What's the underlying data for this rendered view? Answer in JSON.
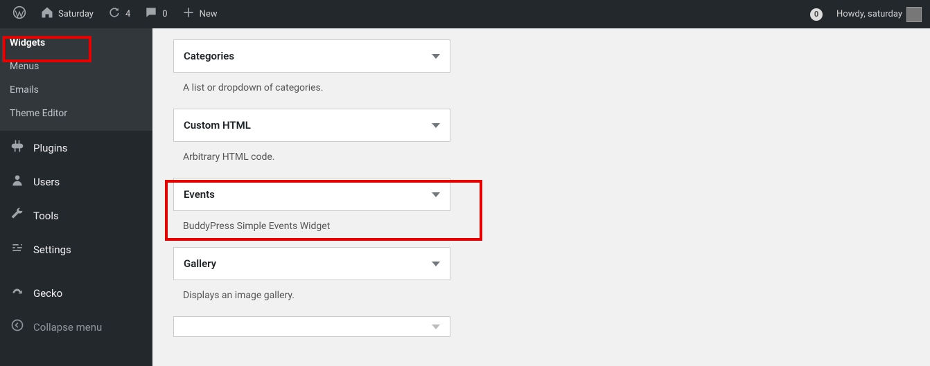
{
  "adminbar": {
    "site_name": "Saturday",
    "updates_count": "4",
    "comments_count": "0",
    "new_label": "New",
    "notif_count": "0",
    "greeting": "Howdy, saturday"
  },
  "sidebar": {
    "submenu": [
      {
        "label": "Widgets",
        "current": true
      },
      {
        "label": "Menus",
        "current": false
      },
      {
        "label": "Emails",
        "current": false
      },
      {
        "label": "Theme Editor",
        "current": false
      }
    ],
    "main": [
      {
        "icon": "plugin-icon",
        "label": "Plugins"
      },
      {
        "icon": "user-icon",
        "label": "Users"
      },
      {
        "icon": "wrench-icon",
        "label": "Tools"
      },
      {
        "icon": "sliders-icon",
        "label": "Settings"
      },
      {
        "icon": "lizard-icon",
        "label": "Gecko"
      }
    ],
    "collapse_label": "Collapse menu"
  },
  "widgets": [
    {
      "title": "Categories",
      "desc": "A list or dropdown of categories."
    },
    {
      "title": "Custom HTML",
      "desc": "Arbitrary HTML code."
    },
    {
      "title": "Events",
      "desc": "BuddyPress Simple Events Widget"
    },
    {
      "title": "Gallery",
      "desc": "Displays an image gallery."
    }
  ]
}
